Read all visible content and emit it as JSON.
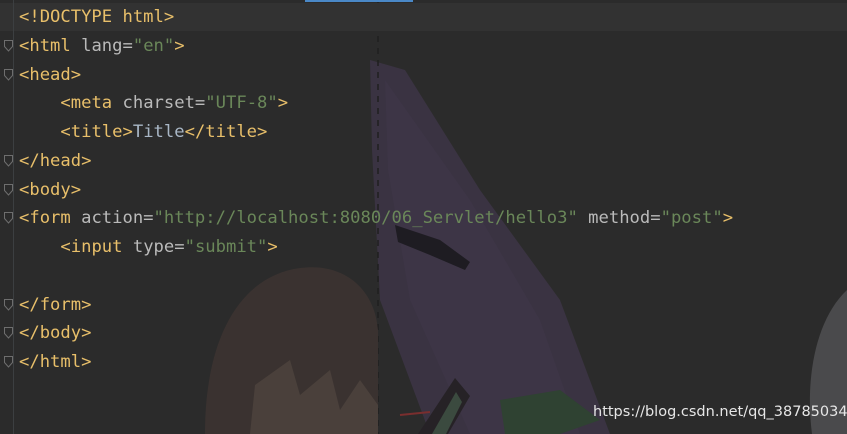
{
  "code_lines": [
    [
      {
        "text": "<!DOCTYPE html>",
        "cls": "t"
      }
    ],
    [
      {
        "text": "<html ",
        "cls": "t"
      },
      {
        "text": "lang=",
        "cls": "a"
      },
      {
        "text": "\"en\"",
        "cls": "v"
      },
      {
        "text": ">",
        "cls": "t"
      }
    ],
    [
      {
        "text": "<head>",
        "cls": "t"
      }
    ],
    [
      {
        "text": "    ",
        "cls": "x"
      },
      {
        "text": "<meta ",
        "cls": "t"
      },
      {
        "text": "charset=",
        "cls": "a"
      },
      {
        "text": "\"UTF-8\"",
        "cls": "v"
      },
      {
        "text": ">",
        "cls": "t"
      }
    ],
    [
      {
        "text": "    ",
        "cls": "x"
      },
      {
        "text": "<title>",
        "cls": "t"
      },
      {
        "text": "Title",
        "cls": "x"
      },
      {
        "text": "</title>",
        "cls": "t"
      }
    ],
    [
      {
        "text": "</head>",
        "cls": "t"
      }
    ],
    [
      {
        "text": "<body>",
        "cls": "t"
      }
    ],
    [
      {
        "text": "<form ",
        "cls": "t"
      },
      {
        "text": "action=",
        "cls": "a"
      },
      {
        "text": "\"http://localhost:8080/06_Servlet/hello3\"",
        "cls": "v"
      },
      {
        "text": " method=",
        "cls": "a"
      },
      {
        "text": "\"post\"",
        "cls": "v"
      },
      {
        "text": ">",
        "cls": "t"
      }
    ],
    [
      {
        "text": "    ",
        "cls": "x"
      },
      {
        "text": "<input ",
        "cls": "t"
      },
      {
        "text": "type=",
        "cls": "a"
      },
      {
        "text": "\"submit\"",
        "cls": "v"
      },
      {
        "text": ">",
        "cls": "t"
      }
    ],
    [],
    [
      {
        "text": "</form>",
        "cls": "t"
      }
    ],
    [
      {
        "text": "</body>",
        "cls": "t"
      }
    ],
    [
      {
        "text": "</html>",
        "cls": "t"
      }
    ]
  ],
  "fold_marker_lines": [
    1,
    2,
    5,
    6,
    7,
    10,
    11,
    12
  ],
  "watermark": "https://blog.csdn.net/qq_38785034",
  "colors": {
    "background": "#2b2b2b",
    "tag": "#e8bf6a",
    "attribute": "#bababa",
    "string": "#6a8759",
    "text": "#a9b7c6",
    "tab_indicator": "#4a88c7"
  }
}
